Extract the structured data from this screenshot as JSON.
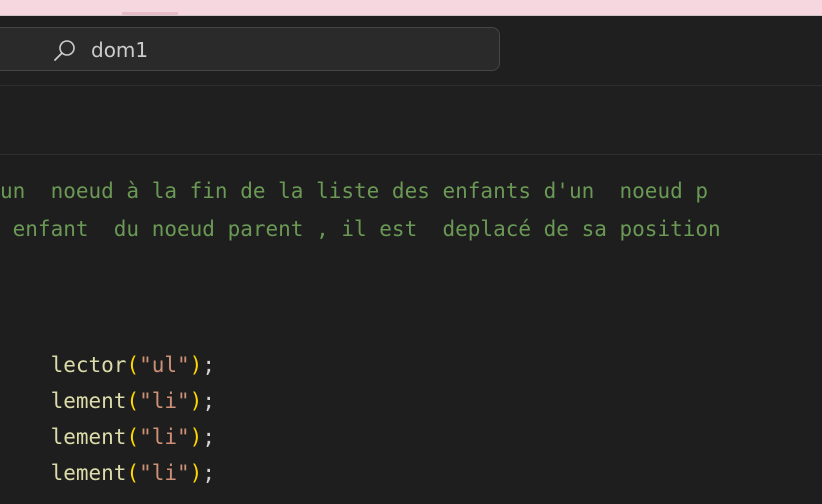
{
  "window": {
    "search_text": "dom1"
  },
  "editor": {
    "lines": [
      {
        "type": "comment",
        "text": "un  noeud à la fin de la liste des enfants d'un  noeud p"
      },
      {
        "type": "comment",
        "text": " enfant  du noeud parent , il est  deplacé de sa position"
      },
      {
        "type": "code",
        "fn": "lector",
        "open": "(",
        "str": "\"ul\"",
        "close": ")",
        "end": ";"
      },
      {
        "type": "code",
        "fn": "lement",
        "open": "(",
        "str": "\"li\"",
        "close": ")",
        "end": ";"
      },
      {
        "type": "code",
        "fn": "lement",
        "open": "(",
        "str": "\"li\"",
        "close": ")",
        "end": ";"
      },
      {
        "type": "code",
        "fn": "lement",
        "open": "(",
        "str": "\"li\"",
        "close": ")",
        "end": ";"
      }
    ]
  },
  "colors": {
    "comment": "#6a9955",
    "function": "#dcdcaa",
    "bracket": "#ffd700",
    "string": "#ce9178",
    "punctuation": "#d4d4d4",
    "background": "#1e1e1e"
  }
}
